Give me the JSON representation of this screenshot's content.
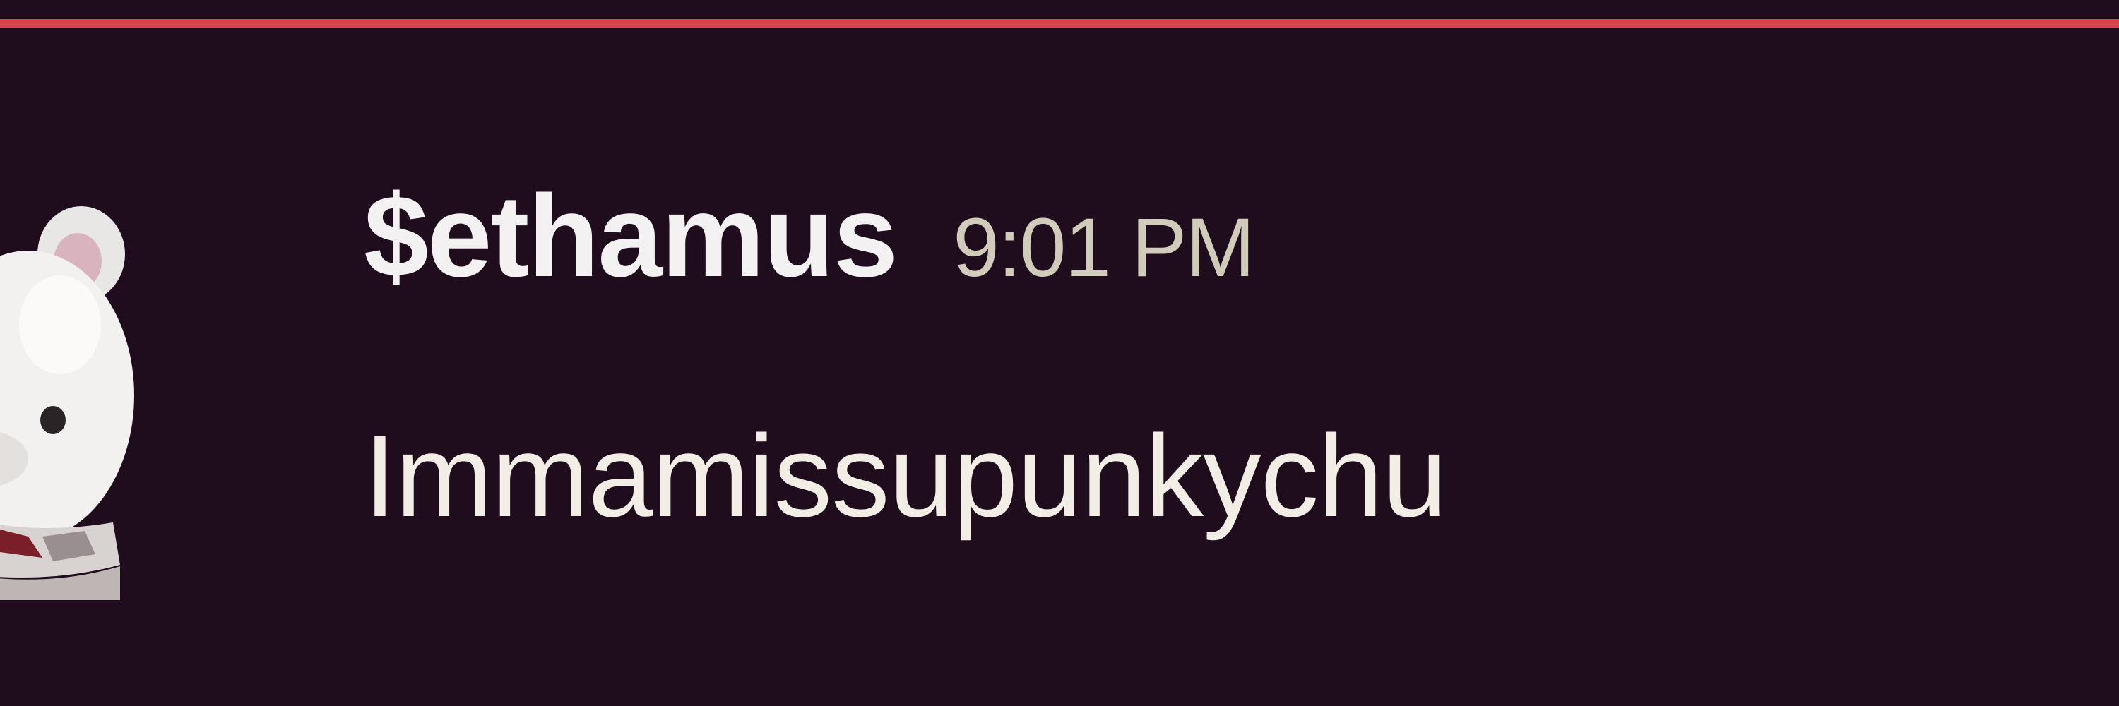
{
  "divider": {
    "color": "#d6434a"
  },
  "message": {
    "author": "$ethamus",
    "timestamp": "9:01 PM",
    "text": "Immamissupunkychu",
    "avatar_icon": "white-bear-avatar-icon"
  },
  "colors": {
    "background": "#1f0d1d",
    "author_text": "#f4f1f3",
    "timestamp_text": "#d1cbbc",
    "message_text": "#f2eee6"
  }
}
